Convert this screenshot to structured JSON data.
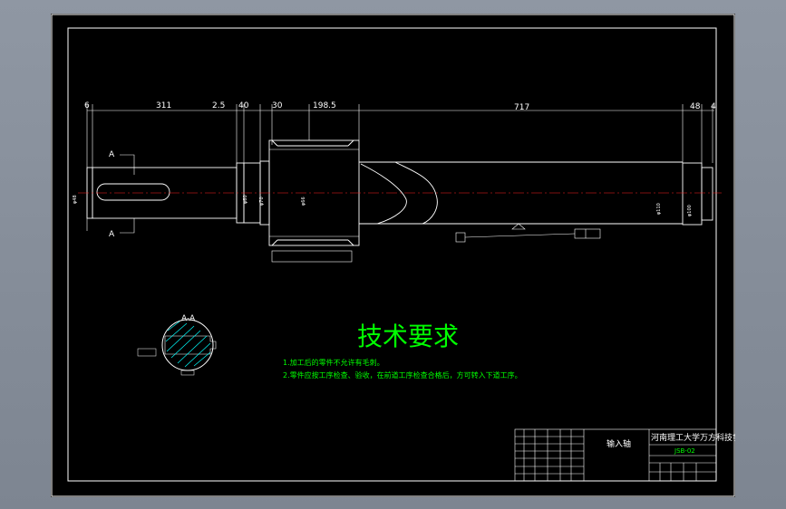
{
  "dimensions": {
    "d6": "6",
    "d311": "311",
    "d25": "2.5",
    "d40": "40",
    "d30": "30",
    "d1985": "198.5",
    "d717": "717",
    "d48": "48",
    "d4": "4"
  },
  "section_labels": {
    "a_top": "A",
    "a_bottom": "A",
    "section_title": "A-A"
  },
  "tech_requirements": {
    "title": "技术要求",
    "item1": "1.加工后的零件不允许有毛刺。",
    "item2": "2.零件应按工序检查、验收，在前道工序检查合格后，方可转入下道工序。"
  },
  "title_block": {
    "part_name": "输入轴",
    "school": "河南理工大学万方科技学院",
    "drawing_no": "JSB-02"
  },
  "colors": {
    "sheet": "#000000",
    "frame": "#ffffff",
    "part": "#ffffff",
    "annotation": "#00ff00",
    "hatch": "#00ffff",
    "background": "#8a929e"
  }
}
